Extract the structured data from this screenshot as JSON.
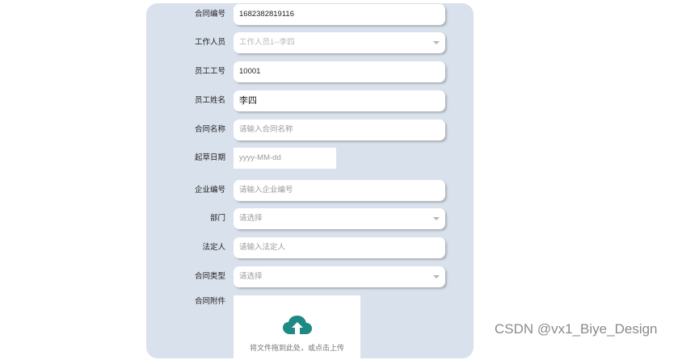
{
  "form": {
    "contract_no": {
      "label": "合同编号",
      "value": "1682382819116"
    },
    "staff": {
      "label": "工作人员",
      "value": "工作人员1--李四"
    },
    "employee_no": {
      "label": "员工工号",
      "value": "10001"
    },
    "employee_name": {
      "label": "员工姓名",
      "value": "李四"
    },
    "contract_name": {
      "label": "合同名称",
      "placeholder": "请输入合同名称"
    },
    "draft_date": {
      "label": "起草日期",
      "placeholder": "yyyy-MM-dd"
    },
    "company_no": {
      "label": "企业编号",
      "placeholder": "请输入企业编号"
    },
    "department": {
      "label": "部门",
      "placeholder": "请选择"
    },
    "legal_person": {
      "label": "法定人",
      "placeholder": "请输入法定人"
    },
    "contract_type": {
      "label": "合同类型",
      "placeholder": "请选择"
    },
    "attachment": {
      "label": "合同附件",
      "hint": "将文件拖到此处，或点击上传"
    }
  },
  "watermark": "CSDN @vx1_Biye_Design",
  "colors": {
    "panel": "#d9e1ec",
    "upload_icon": "#1f8a84"
  }
}
